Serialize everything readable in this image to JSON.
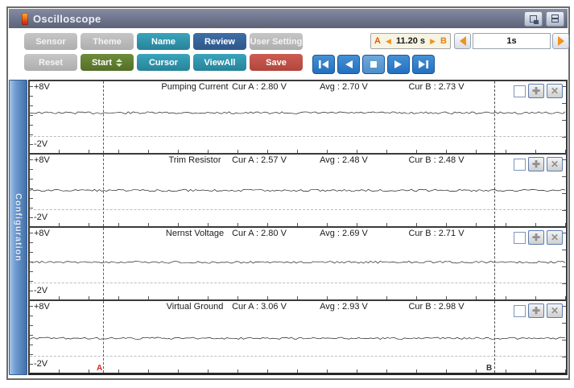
{
  "window": {
    "title": "Oscilloscope"
  },
  "toolbar": {
    "sensor": "Sensor",
    "theme": "Theme",
    "name": "Name",
    "review": "Review",
    "user_setting": "User Setting",
    "reset": "Reset",
    "start": "Start",
    "cursor": "Cursor",
    "viewall": "ViewAll",
    "save": "Save"
  },
  "timebar": {
    "a_label": "A",
    "b_label": "B",
    "ab_time": "11.20 s",
    "timebase": "1s"
  },
  "sidebar": {
    "label": "Configuration"
  },
  "cursors": {
    "a_label": "A",
    "b_label": "B"
  },
  "channels": [
    {
      "name": "Pumping Current",
      "ymax": "+8V",
      "ymin": "-2V",
      "cur_a": "Cur A : 2.80 V",
      "avg": "Avg : 2.70 V",
      "cur_b": "Cur B : 2.73 V",
      "wave_frac": 0.44
    },
    {
      "name": "Trim Resistor",
      "ymax": "+8V",
      "ymin": "-2V",
      "cur_a": "Cur A : 2.57 V",
      "avg": "Avg : 2.48 V",
      "cur_b": "Cur B : 2.48 V",
      "wave_frac": 0.5
    },
    {
      "name": "Nernst Voltage",
      "ymax": "+8V",
      "ymin": "-2V",
      "cur_a": "Cur A : 2.80 V",
      "avg": "Avg : 2.69 V",
      "cur_b": "Cur B : 2.71 V",
      "wave_frac": 0.48
    },
    {
      "name": "Virtual Ground",
      "ymax": "+8V",
      "ymin": "-2V",
      "cur_a": "Cur A : 3.06 V",
      "avg": "Avg : 2.93 V",
      "cur_b": "Cur B : 2.98 V",
      "wave_frac": 0.52
    }
  ],
  "colors": {
    "teal_button": "#2f96ae",
    "review_button": "#336699",
    "start_button": "#5d7d2f",
    "save_button": "#c0504d",
    "playback_button": "#2f7cc6",
    "cursor_a": "#e32222",
    "cursor_b": "#4a4a4a",
    "titlebar": "#6b7288",
    "sidebar": "#6e9bd0",
    "ab_box_bg": "#f7f4e3"
  }
}
